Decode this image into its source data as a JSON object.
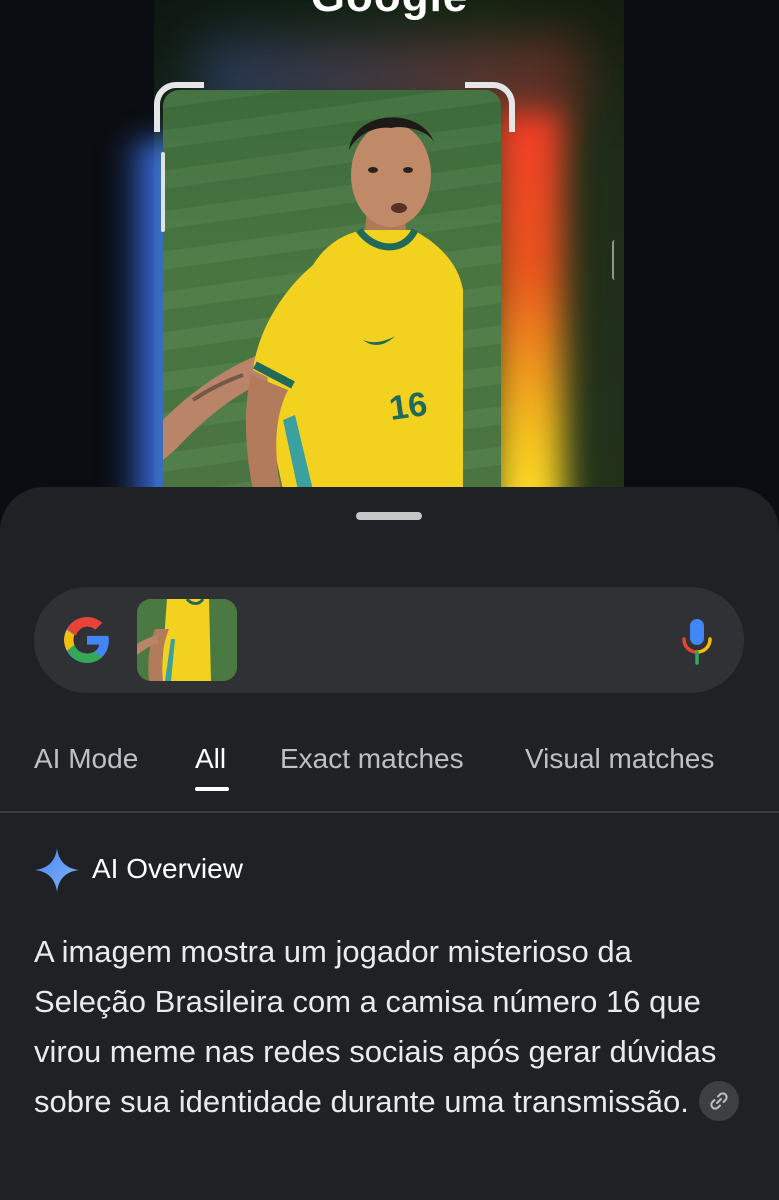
{
  "lens": {
    "brand_text": "Google"
  },
  "search": {
    "mic_label": "Voice search"
  },
  "tabs": [
    {
      "label": "AI Mode"
    },
    {
      "label": "All"
    },
    {
      "label": "Exact matches"
    },
    {
      "label": "Visual matches"
    }
  ],
  "active_tab": "All",
  "ai_overview": {
    "title": "AI Overview",
    "body": "A imagem mostra um jogador misterioso da Seleção Brasileira com a camisa número 16 que virou meme nas redes sociais após gerar dúvidas sobre sua identidade durante uma transmissão."
  },
  "colors": {
    "sheet_bg": "#202124",
    "search_bg": "#303134",
    "accent_blue": "#4285F4",
    "accent_red": "#EA4335",
    "accent_yellow": "#FBBC05",
    "accent_green": "#34A853"
  },
  "icons": [
    "google-g-icon",
    "mic-icon",
    "sparkle-icon",
    "link-icon"
  ]
}
